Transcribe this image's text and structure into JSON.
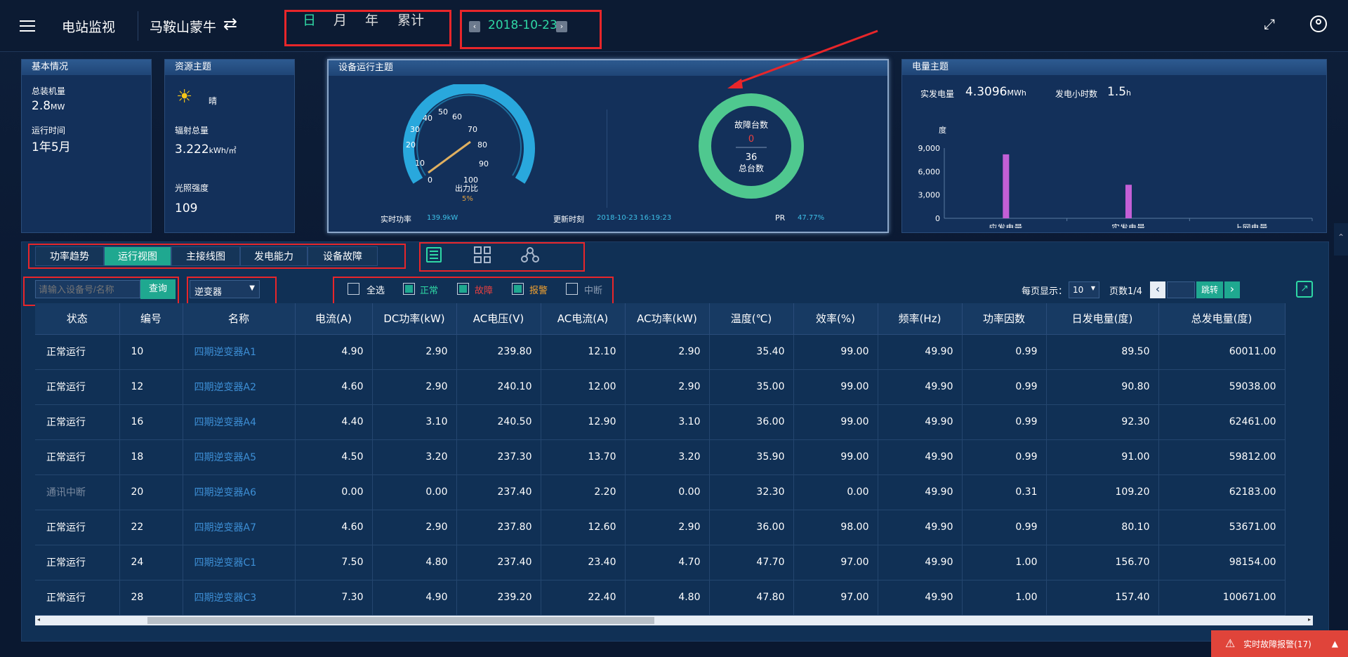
{
  "header": {
    "app_title": "电站监视",
    "station": "马鞍山蒙牛",
    "ranges": [
      "日",
      "月",
      "年",
      "累计"
    ],
    "date": "2018-10-23"
  },
  "basic": {
    "title": "基本情况",
    "capacity_label": "总装机量",
    "capacity_value": "2.8",
    "capacity_unit": "MW",
    "runtime_label": "运行时间",
    "runtime_value": "1年5月"
  },
  "resource": {
    "title": "资源主题",
    "weather": "晴",
    "radiation_label": "辐射总量",
    "radiation_value": "3.222",
    "radiation_unit": "kWh/㎡",
    "light_label": "光照强度",
    "light_value": "109"
  },
  "device": {
    "title": "设备运行主题",
    "gauge_label": "出力比",
    "gauge_value": "5%",
    "gauge_ticks": [
      "0",
      "10",
      "20",
      "30",
      "40",
      "50",
      "60",
      "70",
      "80",
      "90",
      "100"
    ],
    "fault_label": "故障台数",
    "fault_value": "0",
    "total_value": "36",
    "total_label": "总台数",
    "power_label": "实时功率",
    "power_value": "139.9kW",
    "update_label": "更新时刻",
    "update_value": "2018-10-23 16:19:23",
    "pr_label": "PR",
    "pr_value": "47.77%"
  },
  "energy": {
    "title": "电量主题",
    "actual_label": "实发电量",
    "actual_value": "4.3096",
    "actual_unit": "MWh",
    "hours_label": "发电小时数",
    "hours_value": "1.5",
    "hours_unit": "h"
  },
  "chart_data": {
    "type": "bar",
    "ylabel": "度",
    "categories": [
      "应发电量",
      "实发电量",
      "上网电量"
    ],
    "values": [
      8200,
      4300,
      0
    ],
    "ylim": [
      0,
      9000
    ],
    "yticks": [
      "9,000",
      "6,000",
      "3,000",
      "0"
    ],
    "color": "#c35fd6"
  },
  "tabs": [
    "功率趋势",
    "运行视图",
    "主接线图",
    "发电能力",
    "设备故障"
  ],
  "toolbar": {
    "search_placeholder": "请输入设备号/名称",
    "query": "查询",
    "device_type": "逆变器",
    "all": "全选",
    "normal": "正常",
    "fault": "故障",
    "warning": "报警",
    "interrupt": "中断",
    "per_page_label": "每页显示：",
    "per_page": "10",
    "page_label": "页数1/4",
    "jump": "跳转"
  },
  "table": {
    "headers": [
      "状态",
      "编号",
      "名称",
      "电流(A)",
      "DC功率(kW)",
      "AC电压(V)",
      "AC电流(A)",
      "AC功率(kW)",
      "温度(℃)",
      "效率(%)",
      "频率(Hz)",
      "功率因数",
      "日发电量(度)",
      "总发电量(度)"
    ],
    "rows": [
      [
        "正常运行",
        "10",
        "四期逆变器A1",
        "4.90",
        "2.90",
        "239.80",
        "12.10",
        "2.90",
        "35.40",
        "99.00",
        "49.90",
        "0.99",
        "89.50",
        "60011.00"
      ],
      [
        "正常运行",
        "12",
        "四期逆变器A2",
        "4.60",
        "2.90",
        "240.10",
        "12.00",
        "2.90",
        "35.00",
        "99.00",
        "49.90",
        "0.99",
        "90.80",
        "59038.00"
      ],
      [
        "正常运行",
        "16",
        "四期逆变器A4",
        "4.40",
        "3.10",
        "240.50",
        "12.90",
        "3.10",
        "36.00",
        "99.00",
        "49.90",
        "0.99",
        "92.30",
        "62461.00"
      ],
      [
        "正常运行",
        "18",
        "四期逆变器A5",
        "4.50",
        "3.20",
        "237.30",
        "13.70",
        "3.20",
        "35.90",
        "99.00",
        "49.90",
        "0.99",
        "91.00",
        "59812.00"
      ],
      [
        "通讯中断",
        "20",
        "四期逆变器A6",
        "0.00",
        "0.00",
        "237.40",
        "2.20",
        "0.00",
        "32.30",
        "0.00",
        "49.90",
        "0.31",
        "109.20",
        "62183.00"
      ],
      [
        "正常运行",
        "22",
        "四期逆变器A7",
        "4.60",
        "2.90",
        "237.80",
        "12.60",
        "2.90",
        "36.00",
        "98.00",
        "49.90",
        "0.99",
        "80.10",
        "53671.00"
      ],
      [
        "正常运行",
        "24",
        "四期逆变器C1",
        "7.50",
        "4.80",
        "237.40",
        "23.40",
        "4.70",
        "47.70",
        "97.00",
        "49.90",
        "1.00",
        "156.70",
        "98154.00"
      ],
      [
        "正常运行",
        "28",
        "四期逆变器C3",
        "7.30",
        "4.90",
        "239.20",
        "22.40",
        "4.80",
        "47.80",
        "97.00",
        "49.90",
        "1.00",
        "157.40",
        "100671.00"
      ]
    ]
  },
  "alarm": {
    "label": "实时故障报警(17)"
  }
}
